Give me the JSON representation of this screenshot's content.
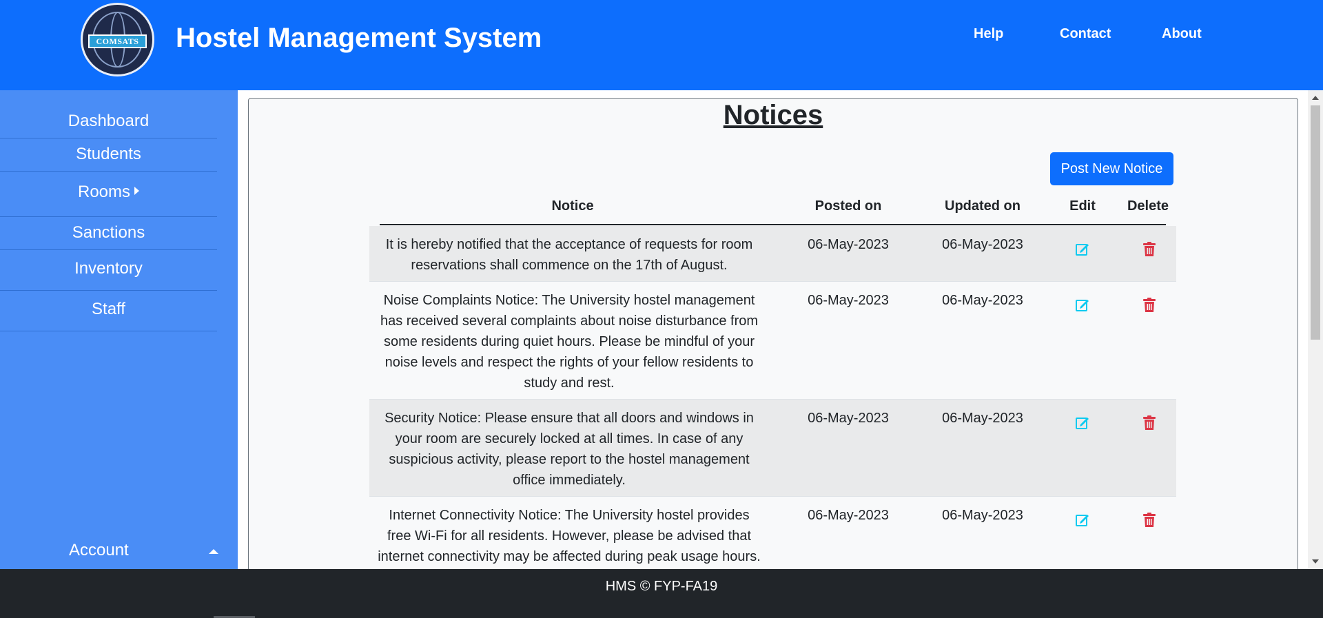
{
  "header": {
    "logo_text": "COMSATS",
    "title": "Hostel Management System",
    "nav": [
      "Help",
      "Contact",
      "About"
    ]
  },
  "sidebar": {
    "items": [
      {
        "label": "Dashboard"
      },
      {
        "label": "Students"
      },
      {
        "label": "Rooms",
        "icon": "caret-right-icon"
      },
      {
        "label": "Sanctions"
      },
      {
        "label": "Inventory"
      },
      {
        "label": "Staff"
      }
    ],
    "account": {
      "label": "Account",
      "icon": "caret-up-icon"
    }
  },
  "main": {
    "title": "Notices",
    "post_button": "Post New Notice",
    "table": {
      "headers": [
        "Notice",
        "Posted on",
        "Updated on",
        "Edit",
        "Delete"
      ],
      "rows": [
        {
          "notice": "It is hereby notified that the acceptance of requests for room reservations shall commence on the 17th of August.",
          "posted": "06-May-2023",
          "updated": "06-May-2023"
        },
        {
          "notice": "Noise Complaints Notice: The University hostel management has received several complaints about noise disturbance from some residents during quiet hours. Please be mindful of your noise levels and respect the rights of your fellow residents to study and rest.",
          "posted": "06-May-2023",
          "updated": "06-May-2023"
        },
        {
          "notice": "Security Notice: Please ensure that all doors and windows in your room are securely locked at all times. In case of any suspicious activity, please report to the hostel management office immediately.",
          "posted": "06-May-2023",
          "updated": "06-May-2023"
        },
        {
          "notice": "Internet Connectivity Notice: The University hostel provides free Wi-Fi for all residents. However, please be advised that internet connectivity may be affected during peak usage hours. We",
          "posted": "06-May-2023",
          "updated": "06-May-2023"
        }
      ]
    }
  },
  "footer": {
    "text": "HMS © FYP-FA19"
  },
  "colors": {
    "primary": "#0d6efd",
    "sidebar": "#4a8df6",
    "footer": "#212529",
    "edit_icon": "#0dcaf0",
    "delete_icon": "#dc3545"
  }
}
